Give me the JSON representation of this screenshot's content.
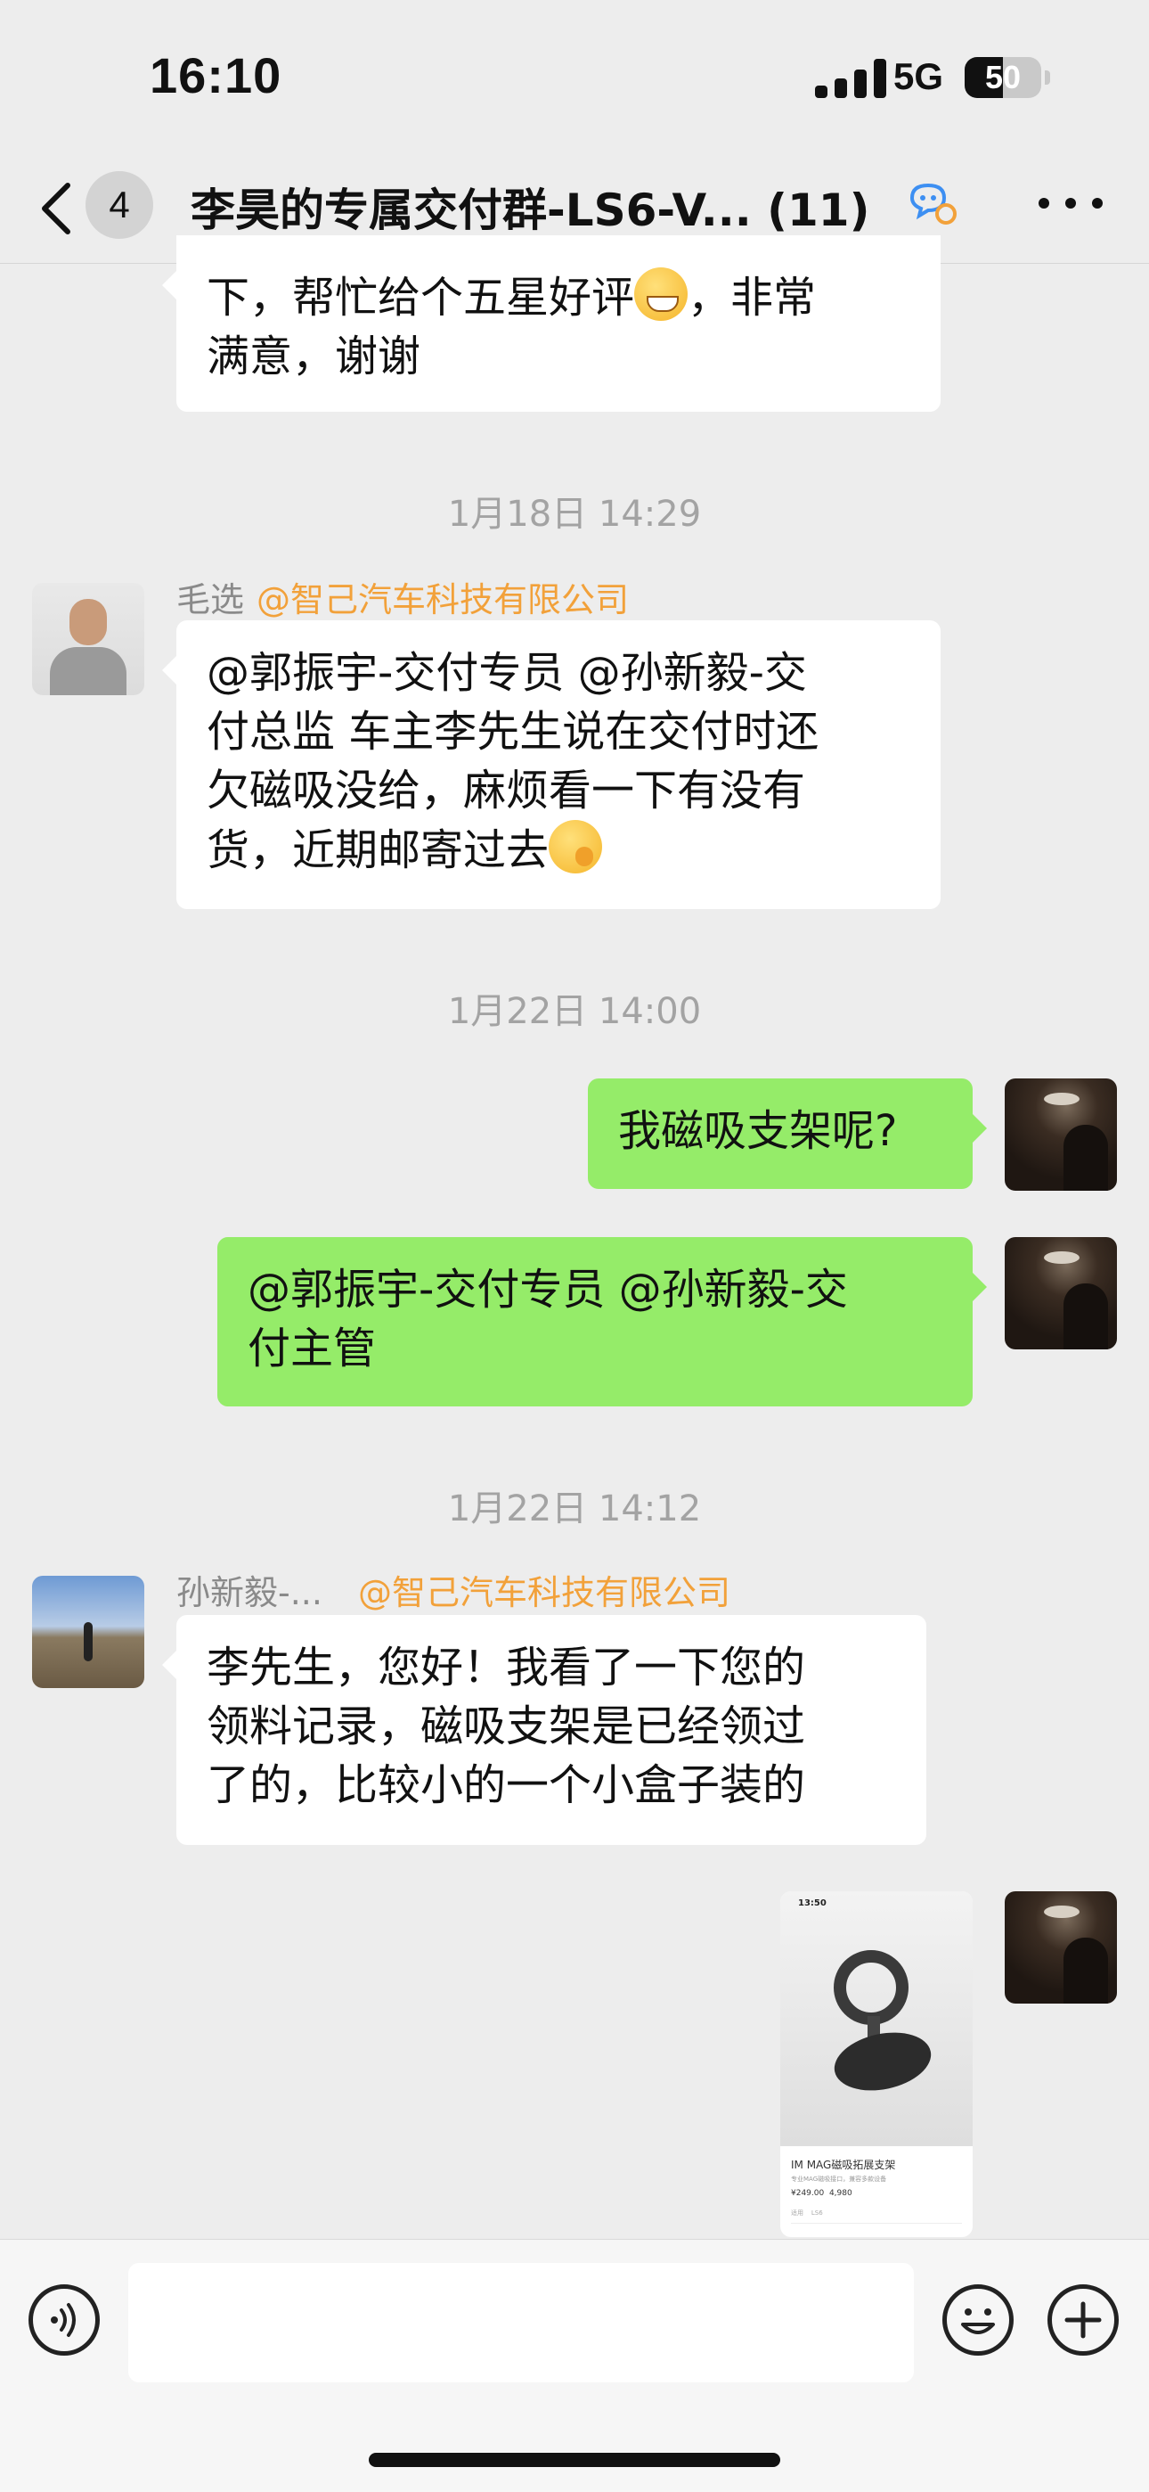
{
  "status_bar": {
    "time": "16:10",
    "network": "5G",
    "battery_level": "50",
    "battery_fraction": 0.5
  },
  "nav": {
    "unread_count": "4",
    "title": "李昊的专属交付群-LS6-V... (11)"
  },
  "messages": {
    "m1": {
      "line1_pre": "下，帮忙给个五星好评",
      "line1_post": "，非常",
      "line2": "满意，谢谢"
    },
    "ts1": "1月18日 14:29",
    "m2": {
      "sender": "毛选",
      "company": "@智己汽车科技有限公司",
      "line1": "@郭振宇-交付专员 @孙新毅-交",
      "line2": "付总监 车主李先生说在交付时还",
      "line3": "欠磁吸没给，麻烦看一下有没有",
      "line4_pre": "货，近期邮寄过去"
    },
    "ts2": "1月22日 14:00",
    "m3": {
      "text": "我磁吸支架呢?"
    },
    "m4": {
      "line1": "@郭振宇-交付专员 @孙新毅-交",
      "line2": "付主管"
    },
    "ts3": "1月22日 14:12",
    "m5": {
      "sender": "孙新毅-...",
      "company": "@智己汽车科技有限公司",
      "line1": "李先生，您好！我看了一下您的",
      "line2": "领料记录，磁吸支架是已经领过",
      "line3": "了的，比较小的一个小盒子装的"
    },
    "m6": {
      "time": "13:50",
      "product_name": "IM MAG磁吸拓展支架",
      "product_sub": "专业MAG磁吸接口，兼容多款设备",
      "price": "¥249.00",
      "points": "4,980",
      "row_label": "适用",
      "row_value": "LS6"
    }
  },
  "input": {
    "value": ""
  },
  "colors": {
    "background": "#ededed",
    "bubble_self": "#95ec69",
    "bubble_other": "#ffffff",
    "company_tag": "#f2a13a",
    "timestamp": "#a3a3a3"
  },
  "icons": [
    "back-chevron-icon",
    "group-chat-icon",
    "more-dots-icon",
    "voice-icon",
    "emoji-icon",
    "plus-icon",
    "grin-emoji-icon",
    "thinking-emoji-icon"
  ]
}
